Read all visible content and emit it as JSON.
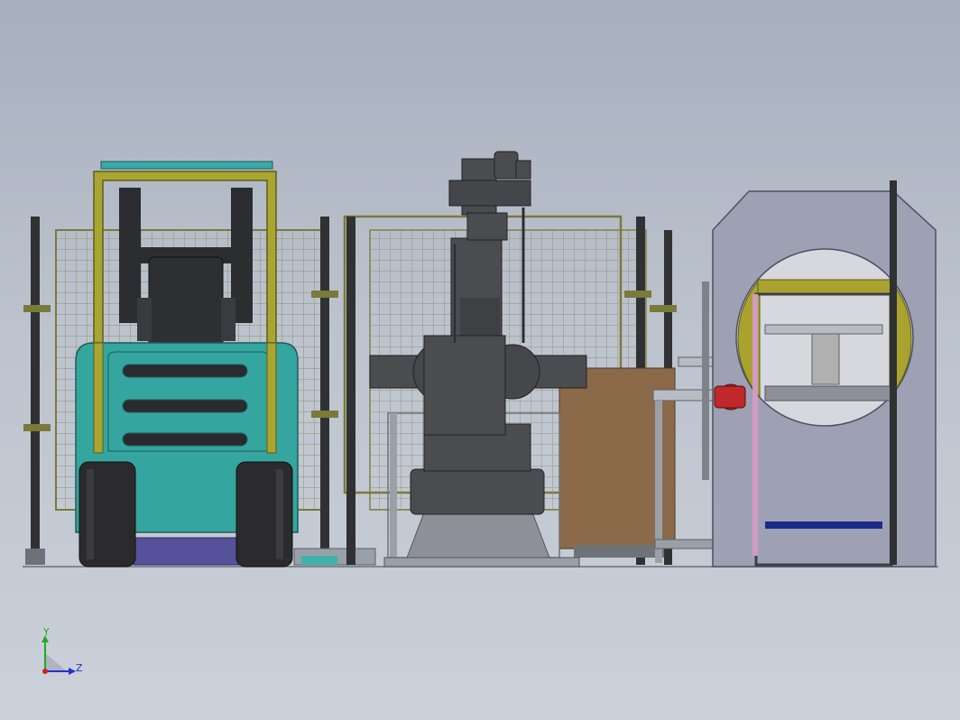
{
  "viewport": {
    "background": "#b6bdc9",
    "axis_triad": {
      "y_label": "Y",
      "z_label": "Z",
      "y_color": "#22aa22",
      "z_color": "#2233cc",
      "x_color": "#cc2222"
    }
  },
  "colors": {
    "fence_mesh": "#8f8f6a",
    "fence_frame": "#7a7a3a",
    "forklift_body": "#35a5a0",
    "forklift_mast": "#a9a531",
    "robot": "#4a4c50",
    "robot_base": "#8d9098",
    "pallet_box": "#8b6a4a",
    "wrapper_frame": "#9ea1b4",
    "wrapper_ring": "#a9a22e",
    "motor_red": "#c0282a",
    "tire": "#2b2b2d"
  }
}
